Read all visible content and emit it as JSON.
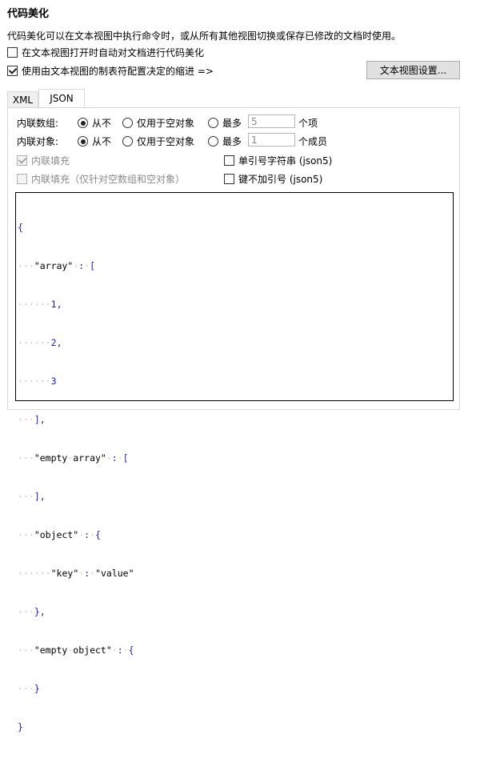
{
  "title": "代码美化",
  "description": "代码美化可以在文本视图中执行命令时，或从所有其他视图切换或保存已修改的文档时使用。",
  "options": {
    "auto_beautify_label": "在文本视图打开时自动对文档进行代码美化",
    "auto_beautify_checked": false,
    "use_tab_indent_label": "使用由文本视图的制表符配置决定的缩进 =>",
    "use_tab_indent_checked": true
  },
  "settings_button_label": "文本视图设置...",
  "tabs": [
    {
      "label": "XML",
      "active": false
    },
    {
      "label": "JSON",
      "active": true
    }
  ],
  "json_panel": {
    "inline_array": {
      "label": "内联数组:",
      "opt_never": "从不",
      "opt_empty_only": "仅用于空对象",
      "opt_max": "最多",
      "max_value": "5",
      "unit": "个项",
      "selected": "never"
    },
    "inline_object": {
      "label": "内联对象:",
      "opt_never": "从不",
      "opt_empty_only": "仅用于空对象",
      "opt_max": "最多",
      "max_value": "1",
      "unit": "个成员",
      "selected": "never"
    },
    "inline_padding_label": "内联填充",
    "inline_padding_checked": true,
    "inline_padding_disabled": true,
    "inline_padding_empty_label": "内联填充（仅针对空数组和空对象）",
    "inline_padding_empty_checked": false,
    "inline_padding_empty_disabled": true,
    "single_quote_label": "单引号字符串 (json5)",
    "single_quote_checked": false,
    "unquoted_keys_label": "键不加引号 (json5)",
    "unquoted_keys_checked": false
  },
  "preview_lines": [
    "{",
    "···\"array\"·:·[",
    "······1,",
    "······2,",
    "······3",
    "···],",
    "···\"empty·array\"·:·[",
    "···],",
    "···\"object\"·:·{",
    "······\"key\"·:·\"value\"",
    "···},",
    "···\"empty·object\"·:·{",
    "···}",
    "}"
  ]
}
